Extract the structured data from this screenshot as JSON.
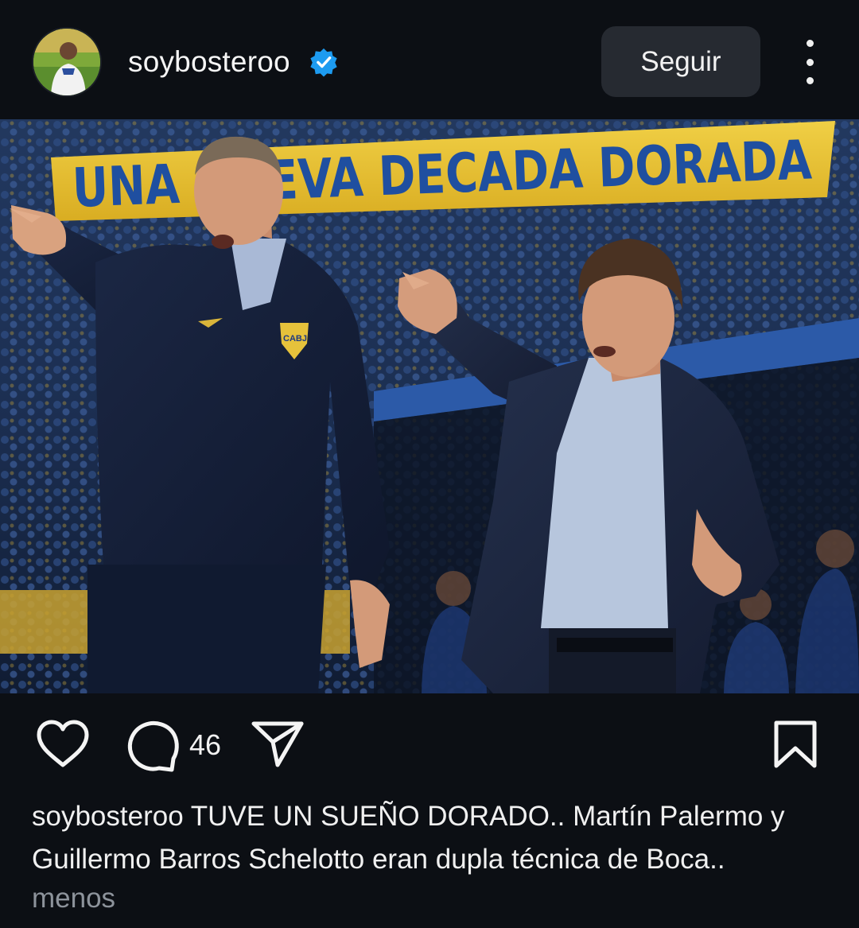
{
  "header": {
    "username": "soybosteroo",
    "follow_label": "Seguir",
    "verified": true
  },
  "media": {
    "banner_text": "UNA NUEVA DECADA DORADA",
    "crest_text": "CABJ"
  },
  "actions": {
    "comment_count": "46"
  },
  "caption": {
    "username": "soybosteroo",
    "text": "TUVE UN SUEÑO DORADO.. Martín Palermo y Guillermo Barros Schelotto eran dupla técnica de Boca..",
    "toggle_label": "menos"
  },
  "colors": {
    "background": "#0c0f14",
    "verified_blue": "#1d9bf0",
    "button_bg": "#262a31",
    "muted_text": "#8d939b",
    "banner_yellow": "#e8c22e",
    "banner_blue": "#1f4fa0"
  },
  "icons": [
    "more-vertical-icon",
    "heart-icon",
    "comment-bubble-icon",
    "send-icon",
    "bookmark-icon",
    "verified-badge-icon"
  ]
}
